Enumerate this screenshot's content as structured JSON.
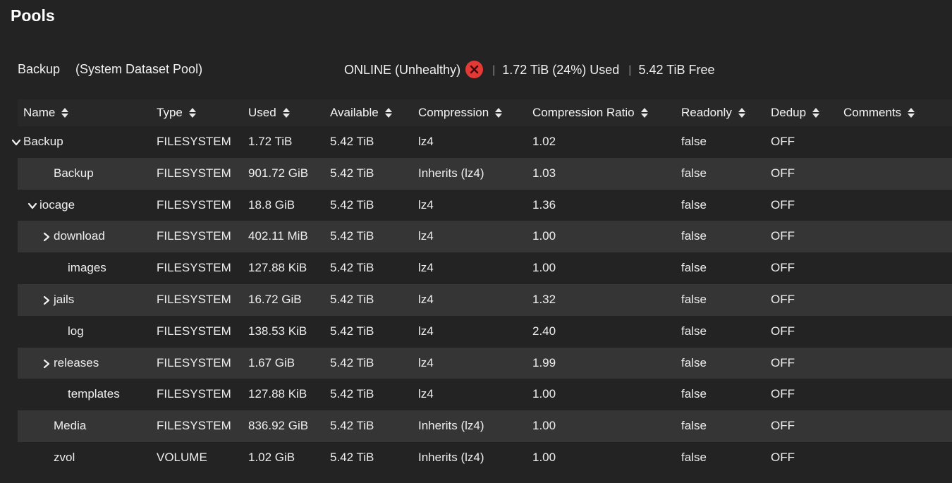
{
  "page": {
    "title": "Pools"
  },
  "pool": {
    "name": "Backup",
    "subtitle": "(System Dataset Pool)",
    "status": "ONLINE (Unhealthy)",
    "status_icon": "error-circle-icon",
    "used": "1.72 TiB (24%) Used",
    "free": "5.42 TiB Free",
    "separator": "|"
  },
  "colors": {
    "background": "#232323",
    "row_alt": "#353535",
    "error": "#e53935"
  },
  "table": {
    "headers": {
      "name": "Name",
      "type": "Type",
      "used": "Used",
      "available": "Available",
      "compression": "Compression",
      "ratio": "Compression Ratio",
      "readonly": "Readonly",
      "dedup": "Dedup",
      "comments": "Comments"
    },
    "rows": [
      {
        "name": "Backup",
        "expander": "expanded",
        "type": "FILESYSTEM",
        "used": "1.72 TiB",
        "available": "5.42 TiB",
        "compression": "lz4",
        "ratio": "1.02",
        "readonly": "false",
        "dedup": "OFF",
        "comments": ""
      },
      {
        "name": "Backup",
        "expander": "none",
        "type": "FILESYSTEM",
        "used": "901.72 GiB",
        "available": "5.42 TiB",
        "compression": "Inherits (lz4)",
        "ratio": "1.03",
        "readonly": "false",
        "dedup": "OFF",
        "comments": ""
      },
      {
        "name": "iocage",
        "expander": "expanded",
        "type": "FILESYSTEM",
        "used": "18.8 GiB",
        "available": "5.42 TiB",
        "compression": "lz4",
        "ratio": "1.36",
        "readonly": "false",
        "dedup": "OFF",
        "comments": ""
      },
      {
        "name": "download",
        "expander": "collapsed",
        "type": "FILESYSTEM",
        "used": "402.11 MiB",
        "available": "5.42 TiB",
        "compression": "lz4",
        "ratio": "1.00",
        "readonly": "false",
        "dedup": "OFF",
        "comments": ""
      },
      {
        "name": "images",
        "expander": "none",
        "type": "FILESYSTEM",
        "used": "127.88 KiB",
        "available": "5.42 TiB",
        "compression": "lz4",
        "ratio": "1.00",
        "readonly": "false",
        "dedup": "OFF",
        "comments": ""
      },
      {
        "name": "jails",
        "expander": "collapsed",
        "type": "FILESYSTEM",
        "used": "16.72 GiB",
        "available": "5.42 TiB",
        "compression": "lz4",
        "ratio": "1.32",
        "readonly": "false",
        "dedup": "OFF",
        "comments": ""
      },
      {
        "name": "log",
        "expander": "none",
        "type": "FILESYSTEM",
        "used": "138.53 KiB",
        "available": "5.42 TiB",
        "compression": "lz4",
        "ratio": "2.40",
        "readonly": "false",
        "dedup": "OFF",
        "comments": ""
      },
      {
        "name": "releases",
        "expander": "collapsed",
        "type": "FILESYSTEM",
        "used": "1.67 GiB",
        "available": "5.42 TiB",
        "compression": "lz4",
        "ratio": "1.99",
        "readonly": "false",
        "dedup": "OFF",
        "comments": ""
      },
      {
        "name": "templates",
        "expander": "none",
        "type": "FILESYSTEM",
        "used": "127.88 KiB",
        "available": "5.42 TiB",
        "compression": "lz4",
        "ratio": "1.00",
        "readonly": "false",
        "dedup": "OFF",
        "comments": ""
      },
      {
        "name": "Media",
        "expander": "none",
        "type": "FILESYSTEM",
        "used": "836.92 GiB",
        "available": "5.42 TiB",
        "compression": "Inherits (lz4)",
        "ratio": "1.00",
        "readonly": "false",
        "dedup": "OFF",
        "comments": ""
      },
      {
        "name": "zvol",
        "expander": "none",
        "type": "VOLUME",
        "used": "1.02 GiB",
        "available": "5.42 TiB",
        "compression": "Inherits (lz4)",
        "ratio": "1.00",
        "readonly": "false",
        "dedup": "OFF",
        "comments": ""
      }
    ]
  }
}
